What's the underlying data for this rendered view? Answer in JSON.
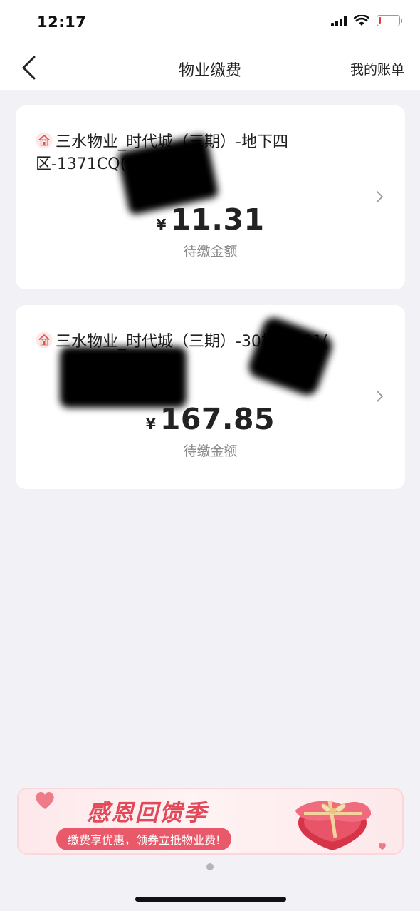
{
  "status_bar": {
    "time": "12:17"
  },
  "nav": {
    "title": "物业缴费",
    "right_link": "我的账单"
  },
  "bills": [
    {
      "title": "三水物业_时代城（三期）-地下四区-1371CQ(",
      "currency": "¥",
      "amount": "11.31",
      "amount_label": "待缴金额"
    },
    {
      "title": "三水物业_时代城（三期）-30栋-1901(",
      "currency": "¥",
      "amount": "167.85",
      "amount_label": "待缴金额"
    }
  ],
  "banner": {
    "title": "感恩回馈季",
    "subtitle": "缴费享优惠，领券立抵物业费!"
  },
  "icons": {
    "back": "chevron-left-icon",
    "house": "house-icon",
    "chevron": "chevron-right-icon",
    "gift": "gift-box-icon"
  },
  "colors": {
    "accent": "#e24a5a",
    "battery_low": "#e53935",
    "background": "#f2f2f6"
  },
  "battery_level": 0.1
}
